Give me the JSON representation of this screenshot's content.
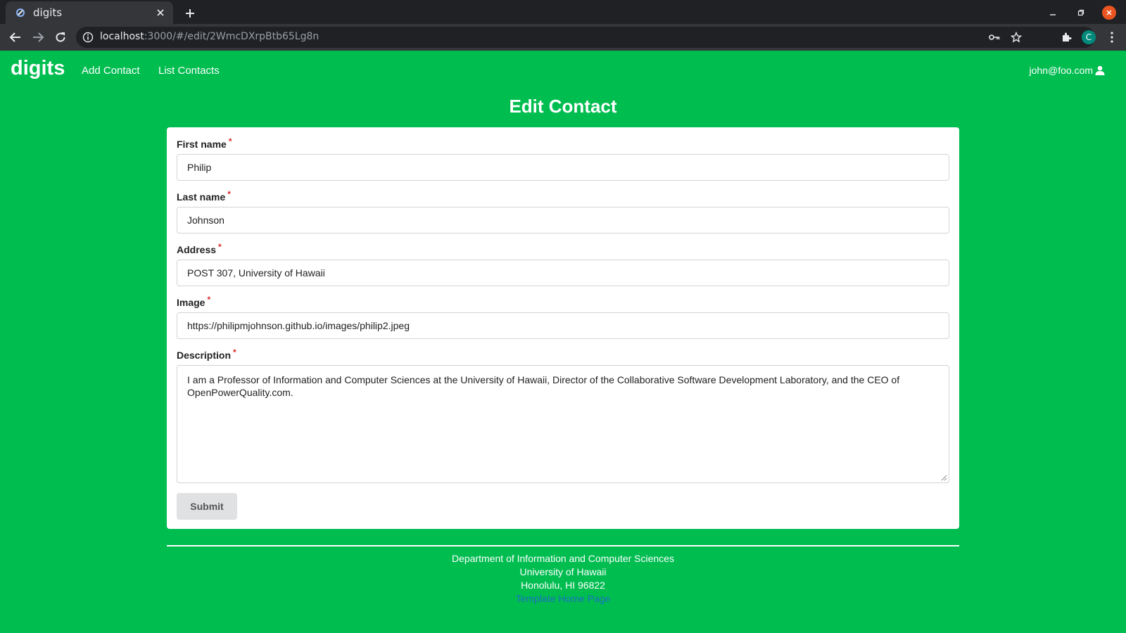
{
  "browser": {
    "tab_title": "digits",
    "url_host": "localhost",
    "url_rest": ":3000/#/edit/2WmcDXrpBtb65Lg8n",
    "profile_initial": "C",
    "icons": [
      "tab-favicon-icon",
      "close-icon",
      "plus-icon",
      "minimize-icon",
      "restore-icon",
      "close-window-icon",
      "back-arrow-icon",
      "forward-arrow-icon",
      "reload-icon",
      "info-icon",
      "key-icon",
      "star-icon",
      "puzzle-icon",
      "kebab-menu-icon"
    ]
  },
  "navbar": {
    "brand": "digits",
    "links": [
      "Add Contact",
      "List Contacts"
    ],
    "user": "john@foo.com",
    "user_icon": "user-icon"
  },
  "page_title": "Edit Contact",
  "form": {
    "required_marker": "*",
    "fields": [
      {
        "label": "First name",
        "value": "Philip"
      },
      {
        "label": "Last name",
        "value": "Johnson"
      },
      {
        "label": "Address",
        "value": "POST 307, University of Hawaii"
      },
      {
        "label": "Image",
        "value": "https://philipmjohnson.github.io/images/philip2.jpeg"
      }
    ],
    "description": {
      "label": "Description",
      "value": "I am a Professor of Information and Computer Sciences at the University of Hawaii, Director of the Collaborative Software Development Laboratory, and the CEO of OpenPowerQuality.com."
    },
    "submit_label": "Submit"
  },
  "footer": {
    "lines": [
      "Department of Information and Computer Sciences",
      "University of Hawaii",
      "Honolulu, HI 96822"
    ],
    "link": "Template Home Page"
  },
  "colors": {
    "page_background": "#00bd50",
    "link": "#1e70bf",
    "required": "#db2828",
    "button": "#e0e1e2"
  }
}
